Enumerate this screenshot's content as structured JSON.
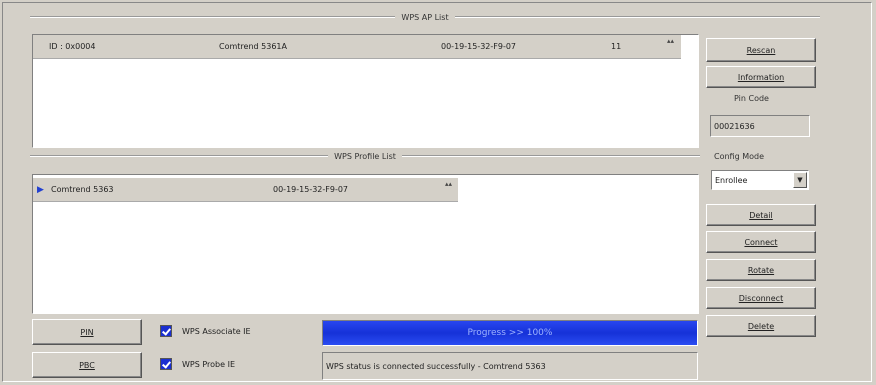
{
  "ap_list": {
    "title": "WPS AP List",
    "rows": [
      {
        "id": "ID : 0x0004",
        "ssid": "Comtrend 5361A",
        "mac": "00-19-15-32-F9-07",
        "channel": "11"
      }
    ]
  },
  "profile_list": {
    "title": "WPS Profile List",
    "rows": [
      {
        "ssid": "Comtrend 5363",
        "mac": "00-19-15-32-F9-07"
      }
    ]
  },
  "buttons": {
    "rescan": "Rescan",
    "information": "Information",
    "detail": "Detail",
    "connect": "Connect",
    "rotate": "Rotate",
    "disconnect": "Disconnect",
    "delete": "Delete",
    "pin": "PIN",
    "pbc": "PBC"
  },
  "pin_code": {
    "label": "Pin Code",
    "value": "00021636"
  },
  "config_mode": {
    "label": "Config Mode",
    "selected": "Enrollee"
  },
  "checks": {
    "associate_ie": "WPS Associate IE",
    "probe_ie": "WPS Probe IE"
  },
  "progress": {
    "text": "Progress >> 100%",
    "percent": 100
  },
  "status_text": "WPS status is connected successfully - Comtrend 5363",
  "colors": {
    "accent": "#1a2fd0",
    "progress": "#1632d8"
  }
}
